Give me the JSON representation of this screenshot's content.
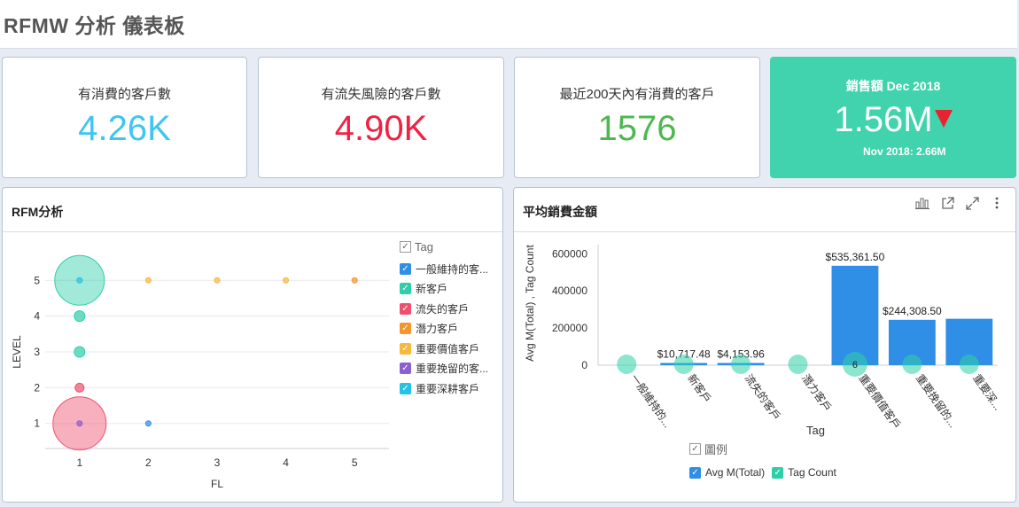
{
  "dashboard": {
    "title": "RFMW 分析 儀表板"
  },
  "kpis": [
    {
      "label": "有消費的客戶數",
      "value": "4.26K",
      "color": "#3ec6f0"
    },
    {
      "label": "有流失風險的客戶數",
      "value": "4.90K",
      "color": "#ee2244"
    },
    {
      "label": "最近200天內有消費的客戶",
      "value": "1576",
      "color": "#4cb84f"
    },
    {
      "label": "銷售額 Dec 2018",
      "value": "1.56M",
      "sub": "Nov 2018: 2.66M",
      "color": "#40d3ad",
      "trend": "down"
    }
  ],
  "rfm_panel": {
    "title": "RFM分析",
    "legend_title": "Tag",
    "legend": [
      {
        "label": "一般維持的客...",
        "color": "#2f8ee6"
      },
      {
        "label": "新客戶",
        "color": "#2ecfa8"
      },
      {
        "label": "流失的客戶",
        "color": "#f0506e"
      },
      {
        "label": "潛力客戶",
        "color": "#f5952b"
      },
      {
        "label": "重要價值客戶",
        "color": "#f6b93b"
      },
      {
        "label": "重要挽留的客...",
        "color": "#8a5fd4"
      },
      {
        "label": "重要深耕客戶",
        "color": "#22c3e6"
      }
    ]
  },
  "avg_panel": {
    "title": "平均銷費金額",
    "legend_title": "圖例",
    "legend": [
      {
        "label": "Avg M(Total)",
        "color": "#2f8ee6"
      },
      {
        "label": "Tag Count",
        "color": "#2ecfa8"
      }
    ],
    "icons": [
      "bar-chart-icon",
      "open-external-icon",
      "expand-icon",
      "more-vertical-icon"
    ]
  },
  "chart_data": [
    {
      "type": "scatter",
      "title": "RFM分析",
      "xlabel": "FL",
      "ylabel": "LEVEL",
      "xticks": [
        "1",
        "2",
        "3",
        "4",
        "5"
      ],
      "yticks": [
        "1",
        "2",
        "3",
        "4",
        "5"
      ],
      "xlim": [
        0.5,
        5.5
      ],
      "ylim": [
        0.3,
        5.7
      ],
      "points": [
        {
          "x": 1,
          "y": 5,
          "size": 28,
          "series": "新客戶"
        },
        {
          "x": 1,
          "y": 5,
          "size": 3,
          "series": "重要深耕客戶"
        },
        {
          "x": 2,
          "y": 5,
          "size": 3,
          "series": "重要價值客戶"
        },
        {
          "x": 3,
          "y": 5,
          "size": 3,
          "series": "重要價值客戶"
        },
        {
          "x": 4,
          "y": 5,
          "size": 3,
          "series": "重要價值客戶"
        },
        {
          "x": 5,
          "y": 5,
          "size": 3,
          "series": "潛力客戶"
        },
        {
          "x": 1,
          "y": 4,
          "size": 6,
          "series": "新客戶"
        },
        {
          "x": 1,
          "y": 3,
          "size": 6,
          "series": "新客戶"
        },
        {
          "x": 1,
          "y": 2,
          "size": 5,
          "series": "流失的客戶"
        },
        {
          "x": 1,
          "y": 1,
          "size": 30,
          "series": "流失的客戶"
        },
        {
          "x": 1,
          "y": 1,
          "size": 3,
          "series": "重要挽留的客..."
        },
        {
          "x": 2,
          "y": 1,
          "size": 3,
          "series": "一般維持的客..."
        }
      ],
      "legend_position": "right"
    },
    {
      "type": "bar",
      "title": "平均銷費金額",
      "xlabel": "Tag",
      "ylabel": "Avg M(Total) , Tag Count",
      "categories": [
        "一般維持的...",
        "新客戶",
        "流失的客戶",
        "潛力客戶",
        "重要價值客戶",
        "重要挽留的...",
        "重要深..."
      ],
      "ylim": [
        0,
        630000
      ],
      "yticks": [
        "0",
        "200000",
        "400000",
        "600000"
      ],
      "series": [
        {
          "name": "Avg M(Total)",
          "values": [
            0,
            10717.48,
            4153.96,
            0,
            535361.5,
            244308.5,
            250000
          ],
          "labels": [
            "",
            "$10,717.48",
            "$4,153.96",
            "",
            "$535,361.50",
            "$244,308.50",
            ""
          ]
        },
        {
          "name": "Tag Count",
          "values": [
            0,
            0,
            0,
            0,
            6,
            0,
            0
          ],
          "marker_labels": [
            "",
            "",
            "",
            "",
            "6",
            "",
            ""
          ]
        }
      ],
      "legend_position": "bottom"
    }
  ]
}
